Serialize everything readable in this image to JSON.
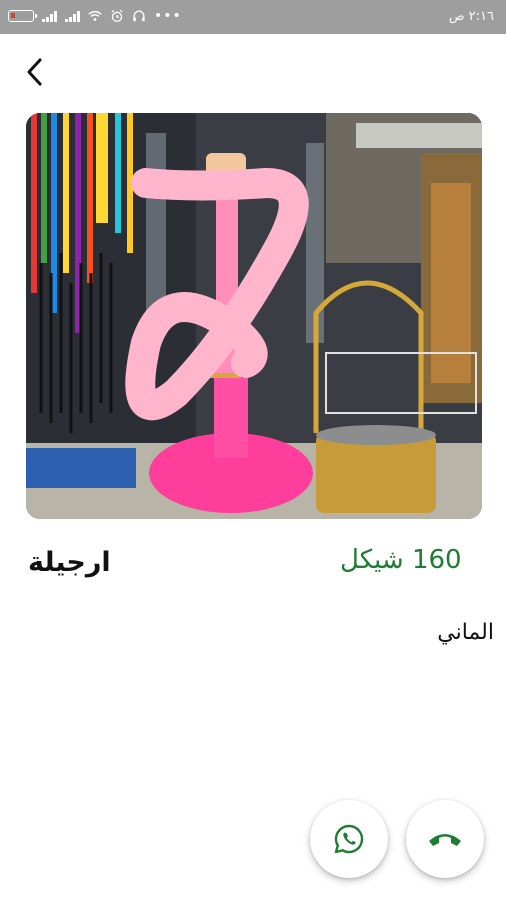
{
  "status_bar": {
    "time": "٢:١٦ ص",
    "icons": [
      "battery-icon",
      "signal-icon",
      "signal-icon",
      "wifi-icon",
      "alarm-icon",
      "headphones-icon",
      "more-dots-icon"
    ]
  },
  "nav": {
    "back_icon": "chevron-left-icon"
  },
  "product": {
    "title": "ارجيلة",
    "price": "160 شيكل",
    "description": "الماني",
    "price_color": "#1e7d32"
  },
  "actions": {
    "whatsapp_icon": "whatsapp-icon",
    "call_icon": "phone-icon",
    "accent": "#1e7d32"
  }
}
